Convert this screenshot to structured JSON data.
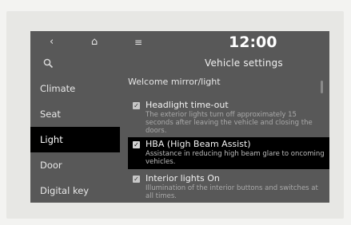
{
  "header": {
    "back_icon": "‹",
    "home_icon": "⌂",
    "menu_icon": "≡",
    "clock": "12:00",
    "title": "Vehicle settings",
    "search_icon": "⚲"
  },
  "sidebar": {
    "items": [
      {
        "label": "Climate"
      },
      {
        "label": "Seat"
      },
      {
        "label": "Light"
      },
      {
        "label": "Door"
      },
      {
        "label": "Digital key"
      }
    ]
  },
  "content": {
    "section_title": "Welcome mirror/light",
    "options": [
      {
        "title": "Headlight time-out",
        "description": "The exterior lights turn off approximately 15 seconds after leaving the vehicle and closing the doors.",
        "checked": true
      },
      {
        "title": "HBA (High Beam Assist)",
        "description": "Assistance in reducing high beam glare to oncoming vehicles.",
        "checked": true
      },
      {
        "title": "Interior lights On",
        "description": "Illumination of the interior buttons and switches at all times.",
        "checked": true
      }
    ]
  },
  "colors": {
    "screen_bg": "#585858",
    "active_bg": "#000000",
    "text": "#f2f2f2"
  }
}
